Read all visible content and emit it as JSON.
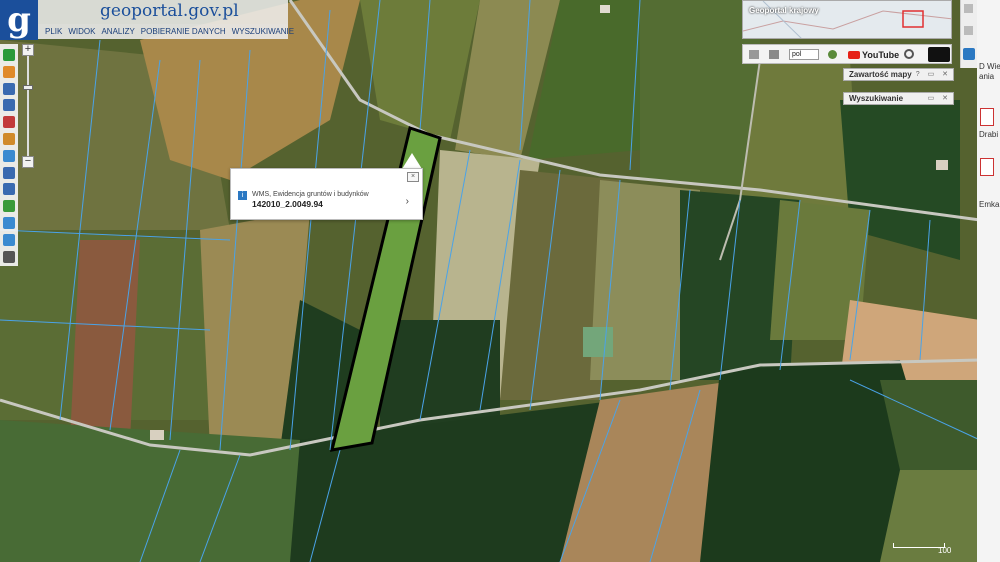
{
  "app": {
    "logo_letter": "g",
    "site_title": "geoportal.gov.pl"
  },
  "menu": [
    "PLIK",
    "WIDOK",
    "ANALIZY",
    "POBIERANIE DANYCH",
    "WYSZUKIWANIE"
  ],
  "left_toolbar": {
    "tools": [
      {
        "icon": "info-icon",
        "color": "#2a9a3a"
      },
      {
        "icon": "pan-hand-icon",
        "color": "#e08a2a"
      },
      {
        "icon": "list-icon",
        "color": "#3a6ab0"
      },
      {
        "icon": "select-icon",
        "color": "#3a6ab0"
      },
      {
        "icon": "print-icon",
        "color": "#c23a3a"
      },
      {
        "icon": "pencil-icon",
        "color": "#d08a2a"
      },
      {
        "icon": "measure-icon",
        "color": "#3a8ad0"
      },
      {
        "icon": "zoom-search-icon",
        "color": "#3a6ab0"
      },
      {
        "icon": "zoom-out-icon",
        "color": "#3a6ab0"
      },
      {
        "icon": "globe-icon",
        "color": "#3a9a3a"
      },
      {
        "icon": "arrow-back-icon",
        "color": "#3a8ad0"
      },
      {
        "icon": "arrow-forward-icon",
        "color": "#3a8ad0"
      },
      {
        "icon": "compass-icon",
        "color": "#555555"
      }
    ]
  },
  "zoom": {
    "plus_label": "+",
    "minus_label": "−"
  },
  "popup": {
    "close_label": "×",
    "info_label": "i",
    "layer_name": "WMS, Ewidencja gruntów i budynków",
    "parcel_id": "142010_2.0049.94",
    "chevron_label": "›"
  },
  "overview": {
    "title": "Geoportal krajowy"
  },
  "right_toolbar": {
    "language": "pol",
    "youtube_label": "YouTube"
  },
  "panels": {
    "map_contents": {
      "title": "Zawartość mapy",
      "buttons": "? ▭ ✕"
    },
    "search": {
      "title": "Wyszukiwanie",
      "buttons": "▭ ✕"
    }
  },
  "desktop_labels": [
    "D Wie",
    "ania",
    "Drabi",
    "Emka"
  ],
  "scale_label": "100",
  "colors": {
    "brand": "#1b4f9b",
    "parcel_outline": "#000000",
    "cadastral_lines": "#4aa3e8"
  }
}
